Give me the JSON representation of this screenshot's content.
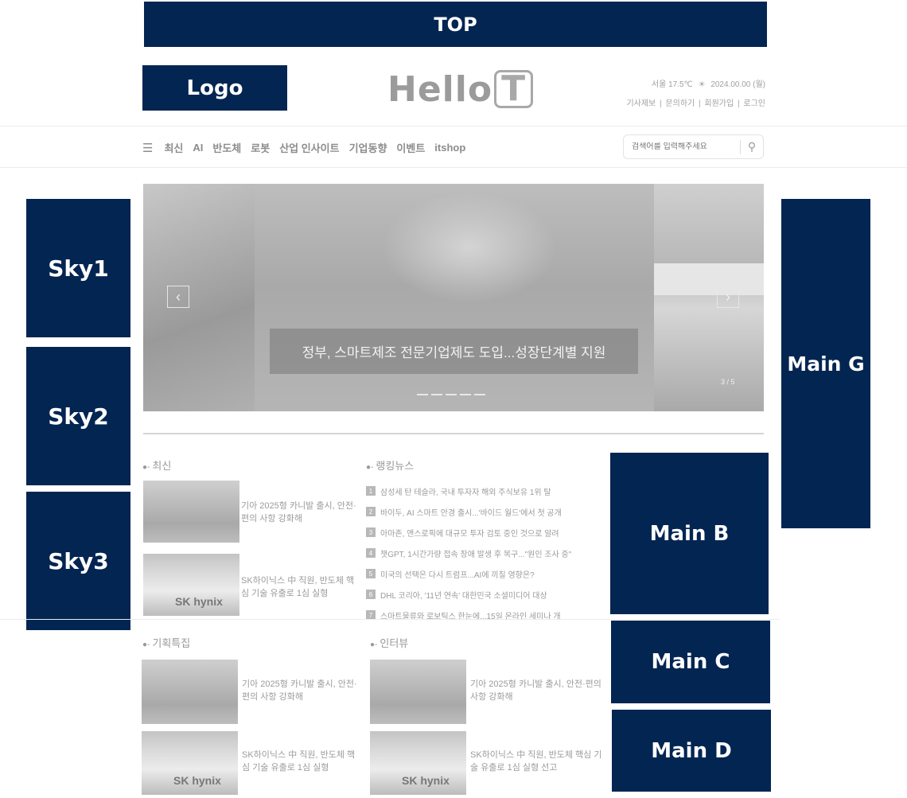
{
  "ads": {
    "top": "TOP",
    "logo": "Logo",
    "sky1": "Sky1",
    "sky2": "Sky2",
    "sky3": "Sky3",
    "main_g": "Main G",
    "main_b": "Main B",
    "main_c": "Main C",
    "main_d": "Main D"
  },
  "header": {
    "logo_main": "Hello",
    "logo_t": "T",
    "weather": "서울 17.5℃",
    "date": "2024.00.00 (월)",
    "links": [
      "기사제보",
      "|",
      "문의하기",
      "|",
      "회원가입",
      "|",
      "로그인"
    ]
  },
  "nav": {
    "menu_icon": "☰",
    "items": [
      "최신",
      "AI",
      "반도체",
      "로봇",
      "산업 인사이트",
      "기업동향",
      "이벤트",
      "itshop"
    ]
  },
  "search": {
    "placeholder": "검색어를 입력해주세요"
  },
  "slider": {
    "caption": "정부, 스마트제조 전문기업제도 도입...성장단계별 지원",
    "counter": "3 / 5",
    "prev_icon": "‹",
    "next_icon": "›"
  },
  "sections": {
    "latest": "최신",
    "ranking": "랭킹뉴스",
    "feature": "기획특집",
    "interview": "인터뷰"
  },
  "latest_items": [
    {
      "text": "기아 2025형 카니발 출시, 안전·편의 사항 강화해"
    },
    {
      "text": "SK하이닉스 中 직원, 반도체 핵심 기술 유출로 1심 실형"
    }
  ],
  "ranking_items": [
    {
      "num": "1",
      "text": "삼성세 탄 테슬라, 국내 투자자 해외 주식보유 1위 탈"
    },
    {
      "num": "2",
      "text": "바이두, AI 스마트 안경 출시...'바이드 월드'에서 첫 공개"
    },
    {
      "num": "3",
      "text": "아마존, 앤스로픽에 대규모 투자 검토 중인 것으로 알려"
    },
    {
      "num": "4",
      "text": "챗GPT, 1시간가량 접속 장애 발생 후 복구...\"원인 조사 중\""
    },
    {
      "num": "5",
      "text": "미국의 선택은 다시 트럼프...AI에 끼칠 영향은?"
    },
    {
      "num": "6",
      "text": "DHL 코리아, '11년 연속' 대한민국 소셜미디어 대상"
    },
    {
      "num": "7",
      "text": "스마트물류와 로보틱스 한눈에...15일 온라인 세미나 개"
    }
  ],
  "feature_items": [
    {
      "text": "기아 2025형 카니발 출시, 안전·편의 사항 강화해"
    },
    {
      "text": "SK하이닉스 中 직원, 반도체 핵심 기술 유출로 1심 실형"
    }
  ],
  "interview_items": [
    {
      "text": "기아 2025형 카니발 출시, 안전·편의 사항 강화해"
    },
    {
      "text": "SK하이닉스 中 직원, 반도체 핵심 기술 유출로 1심 실형 선고"
    }
  ],
  "thumb_brand": "SK hynix",
  "colors": {
    "ad_background": "#032552",
    "ad_text": "#ffffff"
  }
}
